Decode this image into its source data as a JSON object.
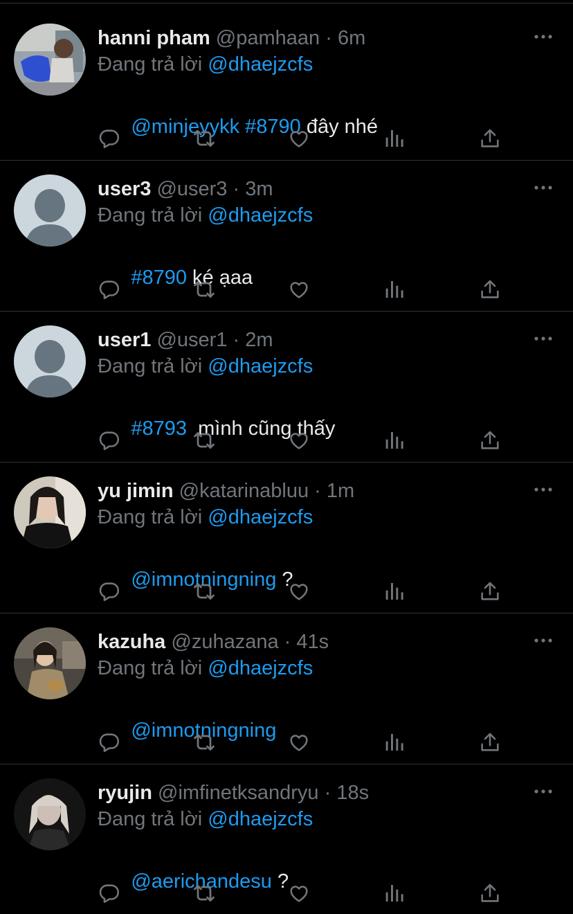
{
  "reply_prefix": "Đang trả lời",
  "replying_to": "@dhaejzcfs",
  "colors": {
    "background": "#000000",
    "text": "#e7e9ea",
    "muted": "#71767b",
    "link": "#1d9bf0",
    "divider": "#2f3336"
  },
  "action_icons": [
    "reply-icon",
    "retweet-icon",
    "like-icon",
    "analytics-icon",
    "share-icon"
  ],
  "tweets": [
    {
      "name": "hanni pham",
      "handle": "@pamhaan",
      "time": "6m",
      "body": [
        {
          "text": "@minjeyykk #8790",
          "link": true
        },
        {
          "text": " đây nhé",
          "link": false
        }
      ]
    },
    {
      "name": "user3",
      "handle": "@user3",
      "time": "3m",
      "body": [
        {
          "text": "#8790",
          "link": true
        },
        {
          "text": " ké ạaa",
          "link": false
        }
      ]
    },
    {
      "name": "user1",
      "handle": "@user1",
      "time": "2m",
      "body": [
        {
          "text": "#8793",
          "link": true
        },
        {
          "text": "  mình cũng thấy",
          "link": false
        }
      ]
    },
    {
      "name": "yu jimin",
      "handle": "@katarinabluu",
      "time": "1m",
      "body": [
        {
          "text": "@imnotningning",
          "link": true
        },
        {
          "text": " ?",
          "link": false
        }
      ]
    },
    {
      "name": "kazuha",
      "handle": "@zuhazana",
      "time": "41s",
      "body": [
        {
          "text": "@imnotningning",
          "link": true
        }
      ]
    },
    {
      "name": "ryujin",
      "handle": "@imfinetksandryu",
      "time": "18s",
      "body": [
        {
          "text": "@aerichandesu",
          "link": true
        },
        {
          "text": " ?",
          "link": false
        }
      ]
    }
  ]
}
